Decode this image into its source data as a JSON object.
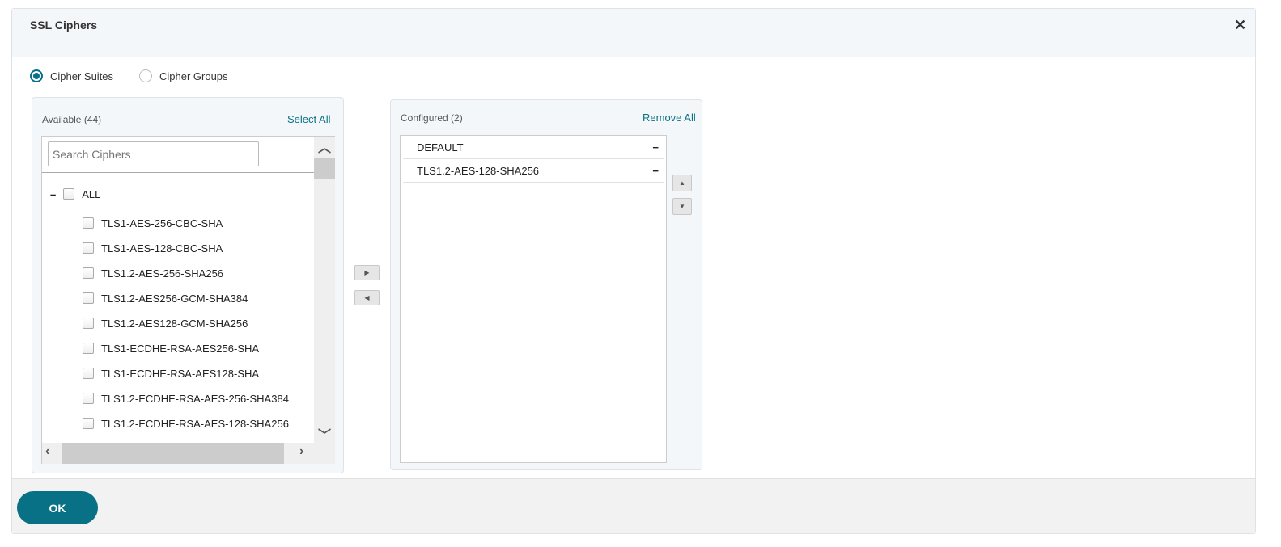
{
  "dialog": {
    "title": "SSL Ciphers",
    "close_icon": "close-icon"
  },
  "mode": {
    "options": [
      {
        "label": "Cipher Suites",
        "selected": true
      },
      {
        "label": "Cipher Groups",
        "selected": false
      }
    ]
  },
  "available": {
    "label": "Available (44)",
    "select_all": "Select All",
    "search_placeholder": "Search Ciphers",
    "all_label": "ALL",
    "items": [
      "TLS1-AES-256-CBC-SHA",
      "TLS1-AES-128-CBC-SHA",
      "TLS1.2-AES-256-SHA256",
      "TLS1.2-AES256-GCM-SHA384",
      "TLS1.2-AES128-GCM-SHA256",
      "TLS1-ECDHE-RSA-AES256-SHA",
      "TLS1-ECDHE-RSA-AES128-SHA",
      "TLS1.2-ECDHE-RSA-AES-256-SHA384",
      "TLS1.2-ECDHE-RSA-AES-128-SHA256"
    ]
  },
  "configured": {
    "label": "Configured (2)",
    "remove_all": "Remove All",
    "items": [
      "DEFAULT",
      "TLS1.2-AES-128-SHA256"
    ],
    "remove_glyph": "−"
  },
  "footer": {
    "ok": "OK"
  },
  "colors": {
    "accent": "#087185"
  }
}
